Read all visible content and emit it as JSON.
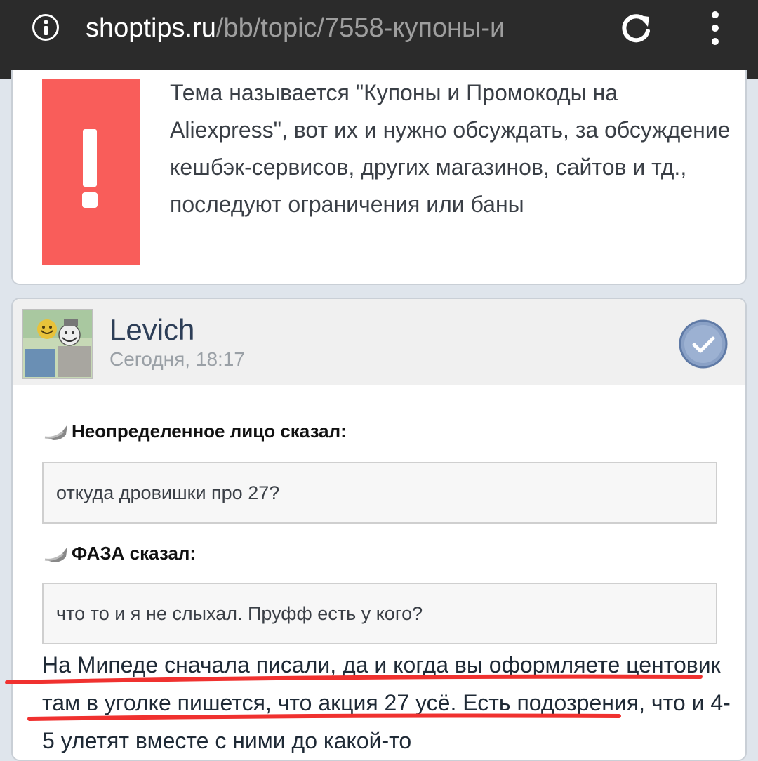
{
  "browser": {
    "url_host": "shoptips.ru",
    "url_path": "/bb/topic/7558-купоны-и"
  },
  "notice": {
    "text": "Тема называется \"Купоны и Промокоды на Aliexpress\", вот их и нужно обсуждать, за обсуждение кешбэк-сервисов, других магазинов, сайтов и тд., последуют ограничения или баны"
  },
  "post": {
    "author": "Levich",
    "time": "Сегодня, 18:17",
    "quotes": [
      {
        "attribution": "Неопределенное лицо сказал:",
        "text": "откуда дровишки про 27?"
      },
      {
        "attribution": "ФАЗА сказал:",
        "text": "что то и я не слыхал. Пруфф есть у кого?"
      }
    ],
    "reply": "На Мипеде сначала писали, да и когда вы оформляете центовик там в уголке пишется, что акция 27 усё. Есть подозрения, что и 4-5 улетят вместе с ними до какой-то"
  },
  "colors": {
    "toolbar": "#2b2b2b",
    "notice_badge": "#f95d5a",
    "underline": "#f0312f",
    "username": "#2d3e57"
  },
  "icons": [
    "info-icon",
    "reload-icon",
    "menu-icon",
    "exclamation-icon",
    "check-icon",
    "quote-arrow-icon"
  ]
}
